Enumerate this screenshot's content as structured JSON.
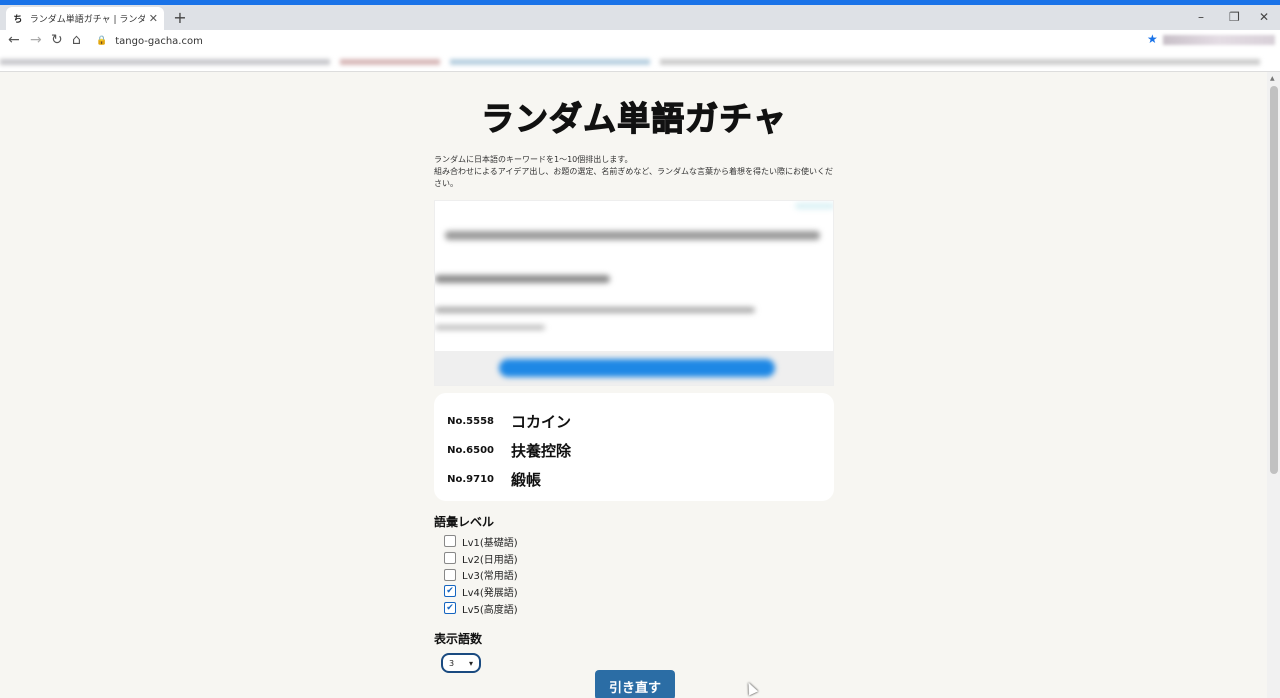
{
  "browser": {
    "tab_title": "ランダム単語ガチャ | ランダムに日本語",
    "url": "tango-gacha.com",
    "favicon_text": "ち"
  },
  "header": {
    "logo_text": "ランダム単語ガチャ"
  },
  "description": {
    "line1": "ランダムに日本語のキーワードを1〜10個排出します。",
    "line2": "組み合わせによるアイデア出し、お題の選定、名前ぎめなど、ランダムな言葉から着想を得たい際にお使いください。"
  },
  "results": [
    {
      "no": "No.5558",
      "word": "コカイン"
    },
    {
      "no": "No.6500",
      "word": "扶養控除"
    },
    {
      "no": "No.9710",
      "word": "緞帳"
    }
  ],
  "vocab_level": {
    "title": "語彙レベル",
    "items": [
      {
        "label": "Lv1(基礎語)",
        "checked": false
      },
      {
        "label": "Lv2(日用語)",
        "checked": false
      },
      {
        "label": "Lv3(常用語)",
        "checked": false
      },
      {
        "label": "Lv4(発展語)",
        "checked": true
      },
      {
        "label": "Lv5(高度語)",
        "checked": true
      }
    ]
  },
  "word_count": {
    "title": "表示語数",
    "selected": "3"
  },
  "redraw_button": "引き直す",
  "colors": {
    "accent": "#1a73e8",
    "button": "#2b6da5",
    "page_bg": "#f7f6f2"
  }
}
